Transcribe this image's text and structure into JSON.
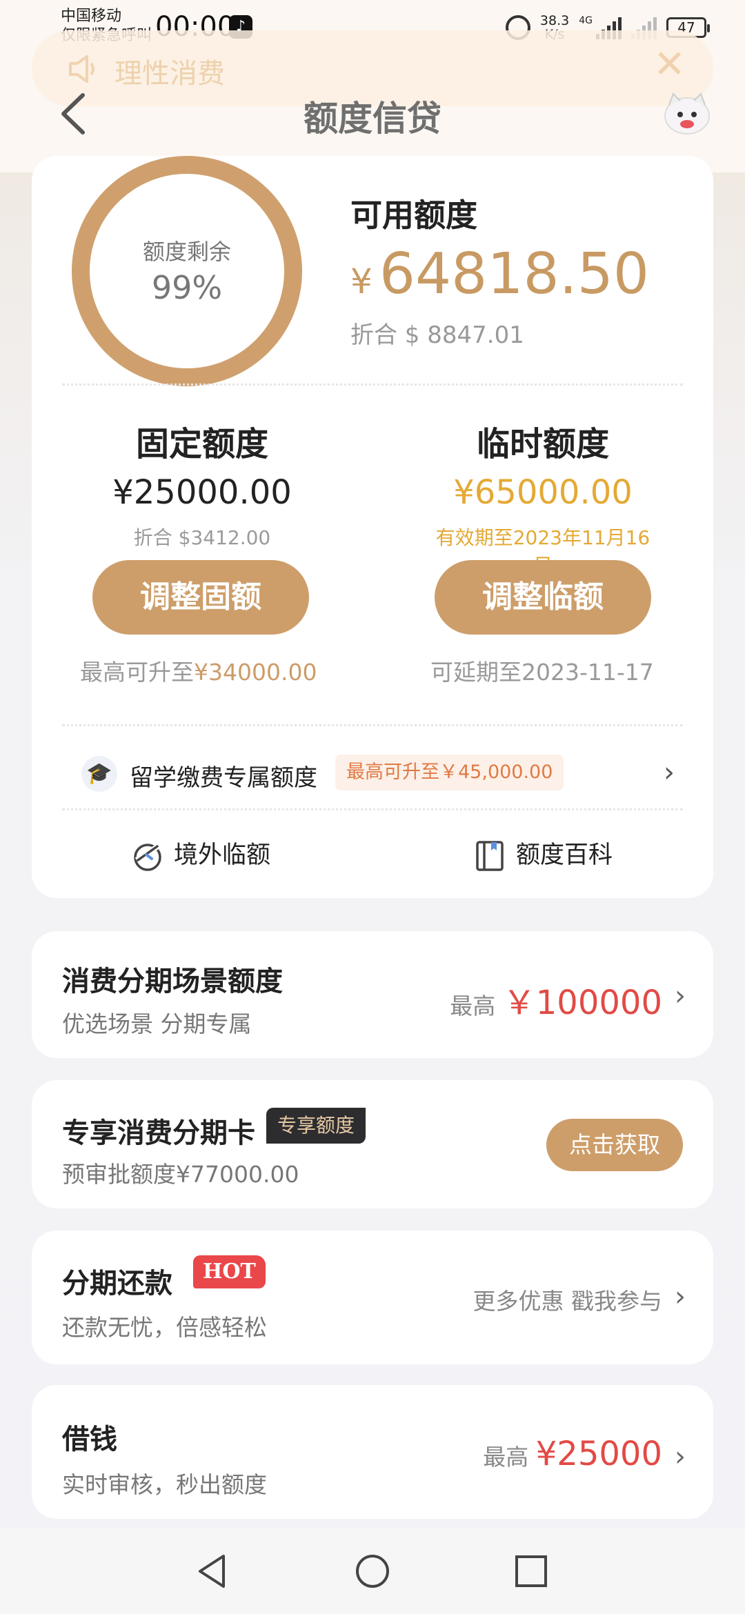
{
  "status_bar": {
    "carrier": "中国移动",
    "emergency": "仅限紧急呼叫",
    "time": "00:00",
    "speed_value": "38.3",
    "speed_unit": "K/s",
    "network": "4G",
    "battery": "47"
  },
  "notice": {
    "text": "理性消费",
    "icon": "speaker-icon"
  },
  "header": {
    "title": "额度信贷"
  },
  "credit": {
    "remain_label": "额度剩余",
    "remain_percent": "99%",
    "remain_fraction": 0.99,
    "available_label": "可用额度",
    "currency": "¥",
    "available_amount": "64818.50",
    "converted": "折合 $ 8847.01"
  },
  "fixed": {
    "title": "固定额度",
    "amount": "¥25000.00",
    "converted": "折合 $3412.00",
    "button": "调整固额",
    "foot_prefix": "最高可升至",
    "foot_value": "¥34000.00"
  },
  "temporary": {
    "title": "临时额度",
    "amount": "¥65000.00",
    "validity": "有效期至2023年11月16日",
    "button": "调整临额",
    "foot": "可延期至2023-11-17"
  },
  "study_abroad": {
    "label": "留学缴费专属额度",
    "tag": "最高可升至￥45,000.00"
  },
  "links": {
    "overseas": "境外临额",
    "wiki": "额度百科"
  },
  "installment_scene": {
    "title": "消费分期场景额度",
    "subtitle": "优选场景 分期专属",
    "right_prefix": "最高",
    "right_value": "￥100000"
  },
  "installment_card": {
    "title": "专享消费分期卡",
    "tag": "专享额度",
    "subtitle": "预审批额度¥77000.00",
    "button": "点击获取"
  },
  "repayment": {
    "title": "分期还款",
    "tag": "HOT",
    "subtitle": "还款无忧，倍感轻松",
    "right": "更多优惠 戳我参与"
  },
  "loan": {
    "title": "借钱",
    "subtitle": "实时审核，秒出额度",
    "right_prefix": "最高",
    "right_value": "¥25000"
  },
  "colors": {
    "gold": "#cd9e6a",
    "accent_yellow": "#e4a935",
    "red": "#e24a45"
  }
}
